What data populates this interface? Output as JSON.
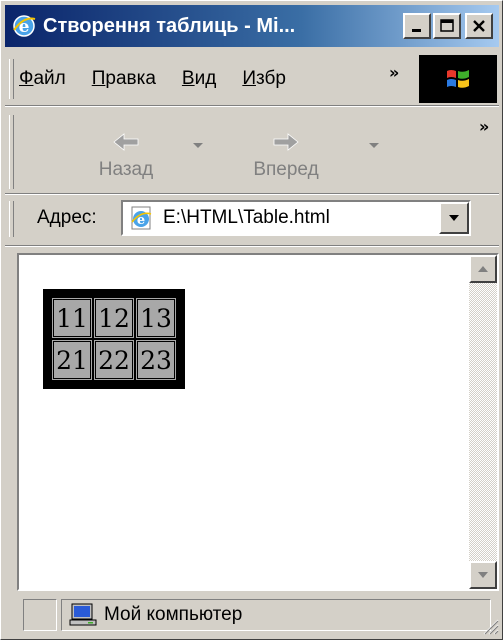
{
  "window": {
    "title": "Створення таблиць - Mi...",
    "controls": {
      "minimize": "_",
      "maximize": "□",
      "close": "✕"
    }
  },
  "menu": {
    "items": [
      {
        "label": "Файл",
        "accel": "Ф",
        "rest": "айл"
      },
      {
        "label": "Правка",
        "accel": "П",
        "rest": "равка"
      },
      {
        "label": "Вид",
        "accel": "В",
        "rest": "ид"
      },
      {
        "label": "Избр",
        "accel": "И",
        "rest": "збр"
      }
    ],
    "more": "»"
  },
  "toolbar": {
    "back_label": "Назад",
    "forward_label": "Вперед",
    "more": "»"
  },
  "address": {
    "label": "Адрес:",
    "value": "E:\\HTML\\Table.html"
  },
  "page": {
    "table_rows": [
      [
        "11",
        "12",
        "13"
      ],
      [
        "21",
        "22",
        "23"
      ]
    ]
  },
  "status": {
    "zone": "Мой компьютер"
  },
  "colors": {
    "titlebar_start": "#0a246a",
    "titlebar_end": "#a6caf0",
    "chrome": "#d4d0c8",
    "cell_bg": "#a8a8a8"
  }
}
